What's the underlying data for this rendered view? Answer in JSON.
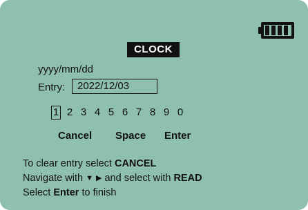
{
  "battery": {
    "level": 1.0,
    "icon": "battery-full-icon"
  },
  "title": "CLOCK",
  "format": "yyyy/mm/dd",
  "entry": {
    "label": "Entry:",
    "value": "2022/12/03"
  },
  "keypad": {
    "digits": [
      "1",
      "2",
      "3",
      "4",
      "5",
      "6",
      "7",
      "8",
      "9",
      "0"
    ],
    "selected_index": 0
  },
  "actions": {
    "cancel": "Cancel",
    "space": "Space",
    "enter": "Enter"
  },
  "help": {
    "line1_prefix": "To clear entry select ",
    "line1_key": "CANCEL",
    "line2_prefix": "Navigate with ",
    "down_arrow": "▼",
    "right_arrow": "▶",
    "line2_middle": " and select with ",
    "line2_key": "READ",
    "line3_prefix": "Select ",
    "line3_key": "Enter",
    "line3_suffix": " to finish"
  },
  "colors": {
    "screen_background": "#8fbfae",
    "text": "#111111"
  }
}
